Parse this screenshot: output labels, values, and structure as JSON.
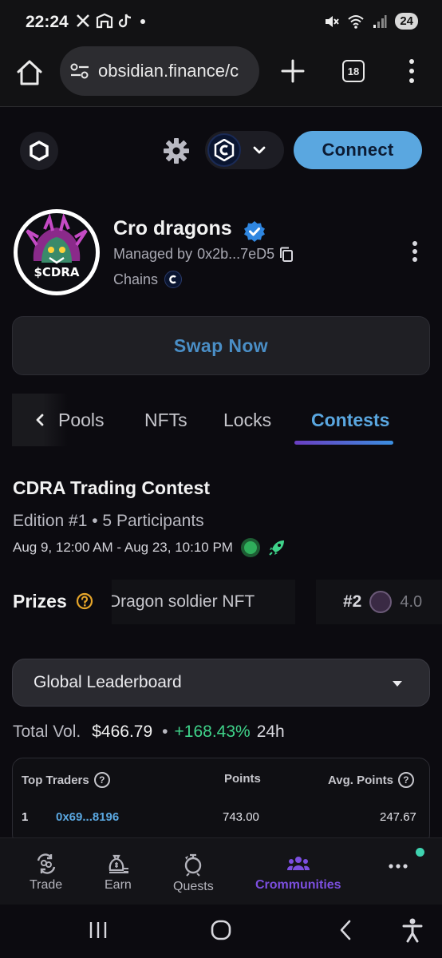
{
  "status_bar": {
    "time": "22:24",
    "battery": "24",
    "left_icons": [
      "x-icon",
      "app-icon",
      "tiktok-icon",
      "dot-icon"
    ],
    "right_icons": [
      "mute-icon",
      "wifi-icon",
      "signal-icon"
    ]
  },
  "browser": {
    "url": "obsidian.finance/c",
    "tab_count": "18"
  },
  "app_header": {
    "connect_label": "Connect",
    "chain_symbol": "C"
  },
  "community": {
    "name": "Cro dragons",
    "managed_by_label": "Managed by",
    "managed_by_address": "0x2b...7eD5",
    "chains_label": "Chains",
    "avatar_text": "$CDRA",
    "swap_label": "Swap Now"
  },
  "tabs": {
    "items": [
      "Pools",
      "NFTs",
      "Locks",
      "Contests"
    ],
    "active": "Contests"
  },
  "contest": {
    "title": "CDRA Trading Contest",
    "edition": "Edition #1 • 5 Participants",
    "dates": "Aug 9, 12:00 AM - Aug 23, 10:10 PM",
    "prizes_label": "Prizes",
    "prize_1_text": "Dragon soldier NFT",
    "prize_2_rank": "#2",
    "prize_2_value": "4.0"
  },
  "leaderboard": {
    "select_value": "Global Leaderboard",
    "total_vol_label": "Total Vol.",
    "total_vol_value": "$466.79",
    "change": "+168.43%",
    "change_period": "24h",
    "columns": [
      "Top Traders",
      "Points",
      "Avg. Points"
    ],
    "rows": [
      {
        "rank": "1",
        "address": "0x69...8196",
        "points": "743.00",
        "avg_points": "247.67"
      }
    ]
  },
  "bottom_nav": {
    "items": [
      {
        "label": "Trade",
        "icon": "trade-icon"
      },
      {
        "label": "Earn",
        "icon": "earn-icon"
      },
      {
        "label": "Quests",
        "icon": "quests-icon"
      },
      {
        "label": "Crommunities",
        "icon": "communities-icon"
      },
      {
        "label": "",
        "icon": "more-icon"
      }
    ],
    "active": "Crommunities"
  },
  "colors": {
    "accent_blue": "#5aa7e0",
    "accent_purple": "#7c4fe0",
    "positive_green": "#3fd38a",
    "background": "#0c0b10"
  }
}
